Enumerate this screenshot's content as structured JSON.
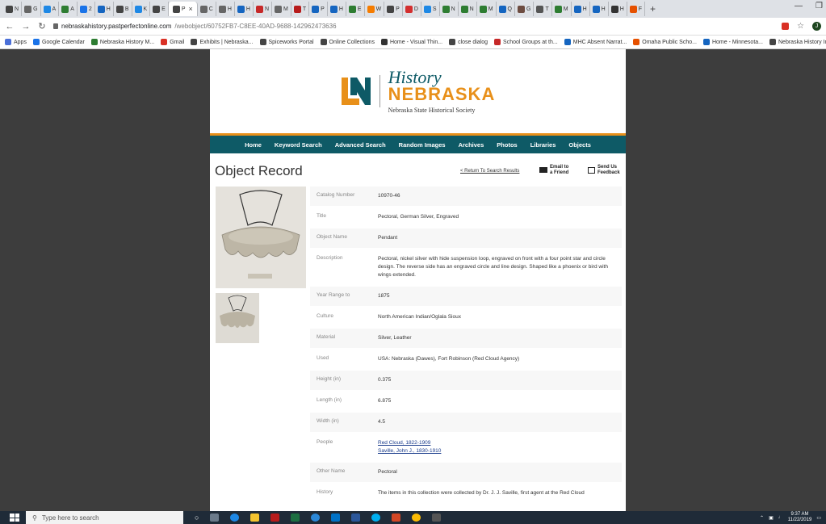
{
  "browser": {
    "tabs": [
      "N",
      "G",
      "A",
      "A",
      "2",
      "H",
      "B",
      "K",
      "E",
      "P",
      "C",
      "H",
      "H",
      "N",
      "M",
      "T",
      "P",
      "H",
      "E",
      "W",
      "P",
      "D",
      "S",
      "N",
      "N",
      "M",
      "Q",
      "G",
      "T",
      "M",
      "H",
      "H",
      "H",
      "F"
    ],
    "active_tab_index": 9,
    "new_tab": "+",
    "url_host": "nebraskahistory.pastperfectonline.com",
    "url_path": "/webobject/60752FB7-C8EE-40AD-9688-142962473636",
    "avatar_letter": "J",
    "bookmarks": [
      {
        "label": "Apps",
        "color": "#4a6fd8"
      },
      {
        "label": "Google Calendar",
        "color": "#1a73e8"
      },
      {
        "label": "Nebraska History M...",
        "color": "#2e7d32"
      },
      {
        "label": "Gmail",
        "color": "#d93025"
      },
      {
        "label": "Exhibits | Nebraska...",
        "color": "#444"
      },
      {
        "label": "Spiceworks Portal",
        "color": "#444"
      },
      {
        "label": "Online Collections",
        "color": "#444"
      },
      {
        "label": "Home - Visual Thin...",
        "color": "#333"
      },
      {
        "label": "close dialog",
        "color": "#444"
      },
      {
        "label": "School Groups at th...",
        "color": "#c62828"
      },
      {
        "label": "MHC Absent Narrat...",
        "color": "#1565c0"
      },
      {
        "label": "Omaha Public Scho...",
        "color": "#e65100"
      },
      {
        "label": "Home - Minnesota...",
        "color": "#1565c0"
      },
      {
        "label": "Nebraska History In...",
        "color": "#444"
      }
    ]
  },
  "site": {
    "logo_history": "History",
    "logo_nebraska": "NEBRASKA",
    "logo_sub": "Nebraska State Historical Society",
    "nav": [
      "Home",
      "Keyword Search",
      "Advanced Search",
      "Random Images",
      "Archives",
      "Photos",
      "Libraries",
      "Objects"
    ]
  },
  "record": {
    "title": "Object Record",
    "return_link": "< Return To Search Results",
    "email_line1": "Email to",
    "email_line2": "a Friend",
    "feedback_line1": "Send Us",
    "feedback_line2": "Feedback",
    "fields": [
      {
        "label": "Catalog Number",
        "value": "10970-46"
      },
      {
        "label": "Title",
        "value": "Pectoral, German Silver, Engraved"
      },
      {
        "label": "Object Name",
        "value": "Pendant"
      },
      {
        "label": "Description",
        "value": "Pectoral, nickel silver with hide suspension loop, engraved on front with a four point star and circle design. The reverse side has an engraved circle and line design. Shaped like a phoenix or bird with wings extended."
      },
      {
        "label": "Year Range to",
        "value": "1875"
      },
      {
        "label": "Culture",
        "value": "North American Indian/Oglala Sioux"
      },
      {
        "label": "Material",
        "value": "Silver, Leather"
      },
      {
        "label": "Used",
        "value": "USA: Nebraska (Dawes), Fort Robinson (Red Cloud Agency)"
      },
      {
        "label": "Height (in)",
        "value": "0.375"
      },
      {
        "label": "Length (in)",
        "value": "6.875"
      },
      {
        "label": "Width (in)",
        "value": "4.5"
      },
      {
        "label": "People",
        "links": [
          "Red Cloud, 1822-1909",
          "Saville, John J., 1830-1910"
        ]
      },
      {
        "label": "Other Name",
        "value": "Pectoral"
      },
      {
        "label": "History",
        "value": "The items in this collection were collected by Dr. J. J. Saville, first agent at the Red Cloud"
      }
    ]
  },
  "taskbar": {
    "search_placeholder": "Type here to search",
    "time": "9:37 AM",
    "date": "11/22/2019"
  }
}
